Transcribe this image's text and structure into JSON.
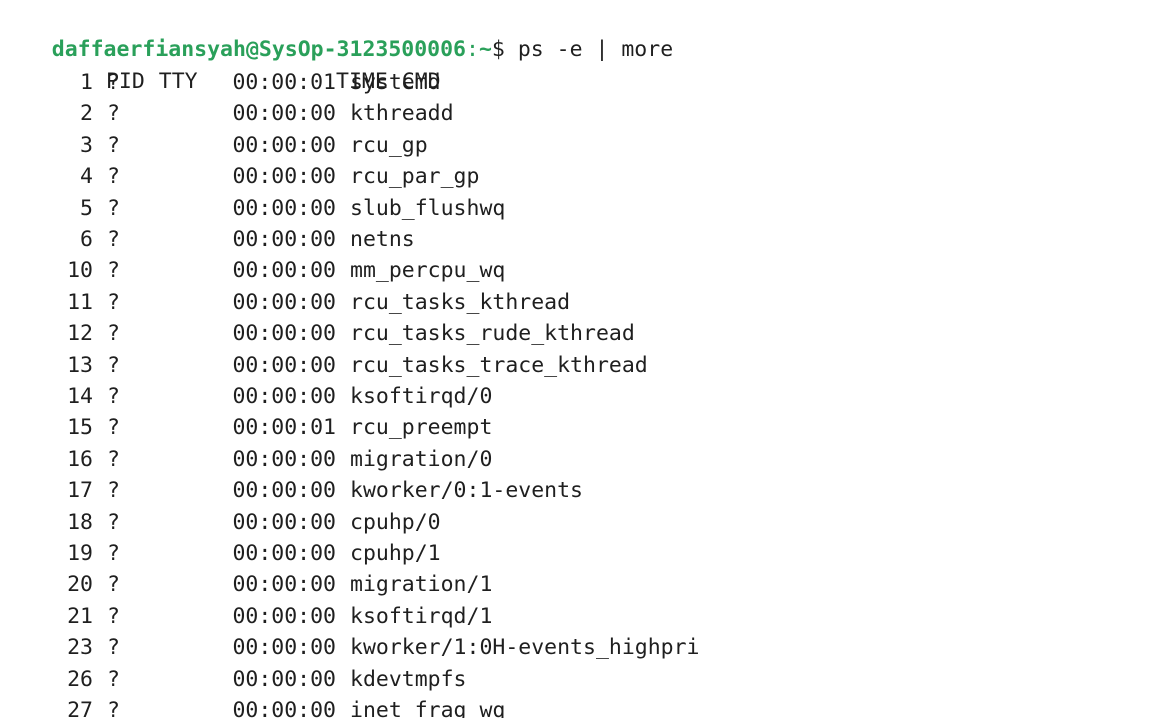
{
  "prompt": {
    "user_host": "daffaerfiansyah@SysOp-3123500006",
    "separator": ":",
    "path": "~",
    "symbol": "$",
    "command": "ps -e | more"
  },
  "table": {
    "headers": {
      "pid": "PID",
      "tty": "TTY",
      "time": "TIME",
      "cmd": "CMD"
    },
    "rows": [
      {
        "pid": "1",
        "tty": "?",
        "time": "00:00:01",
        "cmd": "systemd"
      },
      {
        "pid": "2",
        "tty": "?",
        "time": "00:00:00",
        "cmd": "kthreadd"
      },
      {
        "pid": "3",
        "tty": "?",
        "time": "00:00:00",
        "cmd": "rcu_gp"
      },
      {
        "pid": "4",
        "tty": "?",
        "time": "00:00:00",
        "cmd": "rcu_par_gp"
      },
      {
        "pid": "5",
        "tty": "?",
        "time": "00:00:00",
        "cmd": "slub_flushwq"
      },
      {
        "pid": "6",
        "tty": "?",
        "time": "00:00:00",
        "cmd": "netns"
      },
      {
        "pid": "10",
        "tty": "?",
        "time": "00:00:00",
        "cmd": "mm_percpu_wq"
      },
      {
        "pid": "11",
        "tty": "?",
        "time": "00:00:00",
        "cmd": "rcu_tasks_kthread"
      },
      {
        "pid": "12",
        "tty": "?",
        "time": "00:00:00",
        "cmd": "rcu_tasks_rude_kthread"
      },
      {
        "pid": "13",
        "tty": "?",
        "time": "00:00:00",
        "cmd": "rcu_tasks_trace_kthread"
      },
      {
        "pid": "14",
        "tty": "?",
        "time": "00:00:00",
        "cmd": "ksoftirqd/0"
      },
      {
        "pid": "15",
        "tty": "?",
        "time": "00:00:01",
        "cmd": "rcu_preempt"
      },
      {
        "pid": "16",
        "tty": "?",
        "time": "00:00:00",
        "cmd": "migration/0"
      },
      {
        "pid": "17",
        "tty": "?",
        "time": "00:00:00",
        "cmd": "kworker/0:1-events"
      },
      {
        "pid": "18",
        "tty": "?",
        "time": "00:00:00",
        "cmd": "cpuhp/0"
      },
      {
        "pid": "19",
        "tty": "?",
        "time": "00:00:00",
        "cmd": "cpuhp/1"
      },
      {
        "pid": "20",
        "tty": "?",
        "time": "00:00:00",
        "cmd": "migration/1"
      },
      {
        "pid": "21",
        "tty": "?",
        "time": "00:00:00",
        "cmd": "ksoftirqd/1"
      },
      {
        "pid": "23",
        "tty": "?",
        "time": "00:00:00",
        "cmd": "kworker/1:0H-events_highpri"
      },
      {
        "pid": "26",
        "tty": "?",
        "time": "00:00:00",
        "cmd": "kdevtmpfs"
      },
      {
        "pid": "27",
        "tty": "?",
        "time": "00:00:00",
        "cmd": "inet_frag_wq"
      }
    ]
  }
}
